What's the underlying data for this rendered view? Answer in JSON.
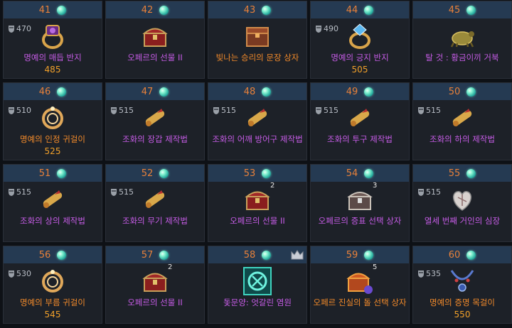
{
  "colors": {
    "header_bg": "#253a52",
    "level_text": "#e8813a",
    "name_purple": "#c65ce6",
    "name_orange": "#f28a2a",
    "price_text": "#f2a12a"
  },
  "items": [
    {
      "level": "41",
      "gear": "470",
      "icon": "ring-purple-icon",
      "name": "명예의 매듭 반지",
      "price": "485",
      "color": "purple"
    },
    {
      "level": "42",
      "icon": "chest-red-icon",
      "name": "오페르의 선물 II",
      "color": "purple"
    },
    {
      "level": "43",
      "icon": "chest-box-icon",
      "name": "빛나는 승리의 문장 상자",
      "color": "orange"
    },
    {
      "level": "44",
      "gear": "490",
      "icon": "ring-blue-icon",
      "name": "명예의 긍지 반지",
      "price": "505",
      "color": "purple"
    },
    {
      "level": "45",
      "icon": "turtle-mount-icon",
      "name": "탈 것 : 황금이끼 거북",
      "color": "purple"
    },
    {
      "level": "46",
      "gear": "510",
      "icon": "earring-icon",
      "name": "명예의 인정 귀걸이",
      "price": "525",
      "color": "orange"
    },
    {
      "level": "47",
      "gear": "515",
      "icon": "scroll-icon",
      "name": "조화의 장갑 제작법",
      "color": "purple"
    },
    {
      "level": "48",
      "gear": "515",
      "icon": "scroll-icon",
      "name": "조화의 어깨 방어구 제작법",
      "color": "purple"
    },
    {
      "level": "49",
      "gear": "515",
      "icon": "scroll-icon",
      "name": "조화의 투구 제작법",
      "color": "purple"
    },
    {
      "level": "50",
      "gear": "515",
      "icon": "scroll-icon",
      "name": "조화의 하의 제작법",
      "color": "purple"
    },
    {
      "level": "51",
      "gear": "515",
      "icon": "scroll-icon",
      "name": "조화의 상의 제작법",
      "color": "purple"
    },
    {
      "level": "52",
      "gear": "515",
      "icon": "scroll-icon",
      "name": "조화의 무기 제작법",
      "color": "purple"
    },
    {
      "level": "53",
      "icon": "chest-red-icon",
      "qty": "2",
      "name": "오페르의 선물 II",
      "color": "purple"
    },
    {
      "level": "54",
      "icon": "chest-silver-icon",
      "qty": "3",
      "name": "오페르의 증표 선택 상자",
      "color": "purple"
    },
    {
      "level": "55",
      "gear": "515",
      "icon": "heart-icon",
      "name": "열세 번째 거인의 심장",
      "color": "purple"
    },
    {
      "level": "56",
      "gear": "530",
      "icon": "earring-icon",
      "name": "명예의 부름 귀걸이",
      "price": "545",
      "color": "orange"
    },
    {
      "level": "57",
      "icon": "chest-red-icon",
      "qty": "2",
      "name": "오페르의 선물 II",
      "color": "purple"
    },
    {
      "level": "58",
      "icon": "emblem-icon",
      "corner": "crown-icon",
      "name": "돛문양: 엇갈린 염원",
      "color": "purple"
    },
    {
      "level": "59",
      "icon": "chest-orange-icon",
      "qty": "5",
      "name": "오페르 진실의 돌 선택 상자",
      "color": "orange"
    },
    {
      "level": "60",
      "gear": "535",
      "icon": "necklace-icon",
      "name": "명예의 증명 목걸이",
      "price": "550",
      "color": "orange"
    }
  ]
}
